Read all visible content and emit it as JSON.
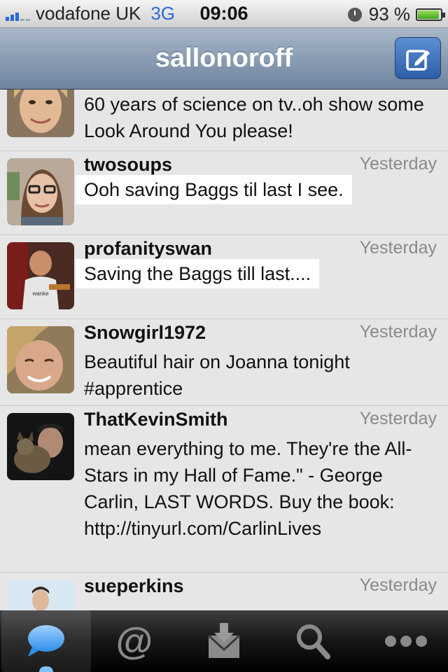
{
  "status_bar": {
    "carrier": "vodafone UK",
    "network": "3G",
    "time": "09:06",
    "battery": "93 %",
    "battery_level": 0.93
  },
  "nav": {
    "title": "sallonoroff",
    "compose_icon": "compose-icon"
  },
  "tweets": [
    {
      "user": "",
      "time": "",
      "text": "60 years of science on tv..oh show some Look Around You please!"
    },
    {
      "user": "twosoups",
      "time": "Yesterday",
      "text": "Ooh saving Baggs til last I see."
    },
    {
      "user": "profanityswan",
      "time": "Yesterday",
      "text": "Saving the Baggs till last...."
    },
    {
      "user": "Snowgirl1972",
      "time": "Yesterday",
      "text": "Beautiful hair on Joanna tonight #apprentice"
    },
    {
      "user": "ThatKevinSmith",
      "time": "Yesterday",
      "text": "mean everything to me. They're the All-Stars in my Hall of Fame.\" - George Carlin, LAST WORDS. Buy the book: http://tinyurl.com/CarlinLives"
    },
    {
      "user": "sueperkins",
      "time": "Yesterday",
      "text": ""
    }
  ],
  "tabs": [
    {
      "name": "timeline",
      "icon": "speech-bubble-icon",
      "active": true
    },
    {
      "name": "mentions",
      "icon": "at-sign-icon",
      "active": false
    },
    {
      "name": "messages",
      "icon": "inbox-icon",
      "active": false
    },
    {
      "name": "search",
      "icon": "magnifier-icon",
      "active": false
    },
    {
      "name": "more",
      "icon": "ellipsis-icon",
      "active": false
    }
  ],
  "colors": {
    "nav_bar": "#7f93ad",
    "accent_blue": "#2a6bd6",
    "timestamp": "#8a8a8a"
  }
}
